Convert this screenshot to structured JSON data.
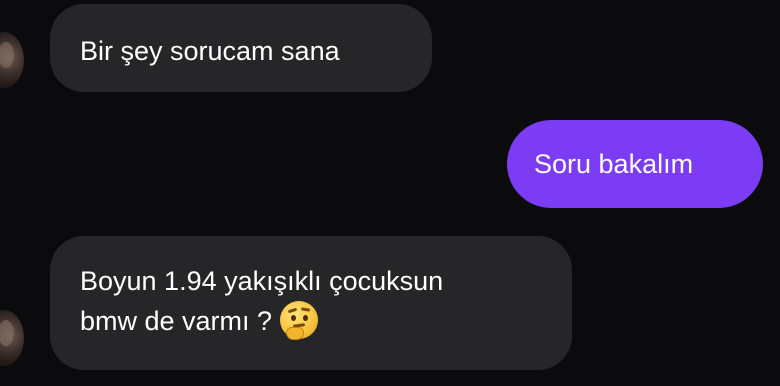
{
  "messages": [
    {
      "direction": "incoming",
      "lines": [
        "Bir şey sorucam sana"
      ]
    },
    {
      "direction": "outgoing",
      "lines": [
        "Soru bakalım"
      ]
    },
    {
      "direction": "incoming",
      "lines": [
        "Boyun 1.94 yakışıklı çocuksun",
        "bmw de varmı ?"
      ],
      "emoji": "thinking-face-icon"
    }
  ],
  "colors": {
    "background": "#0b0b0d",
    "incoming_bubble": "#262628",
    "outgoing_bubble": "#7c3cf5",
    "text": "#ffffff"
  }
}
